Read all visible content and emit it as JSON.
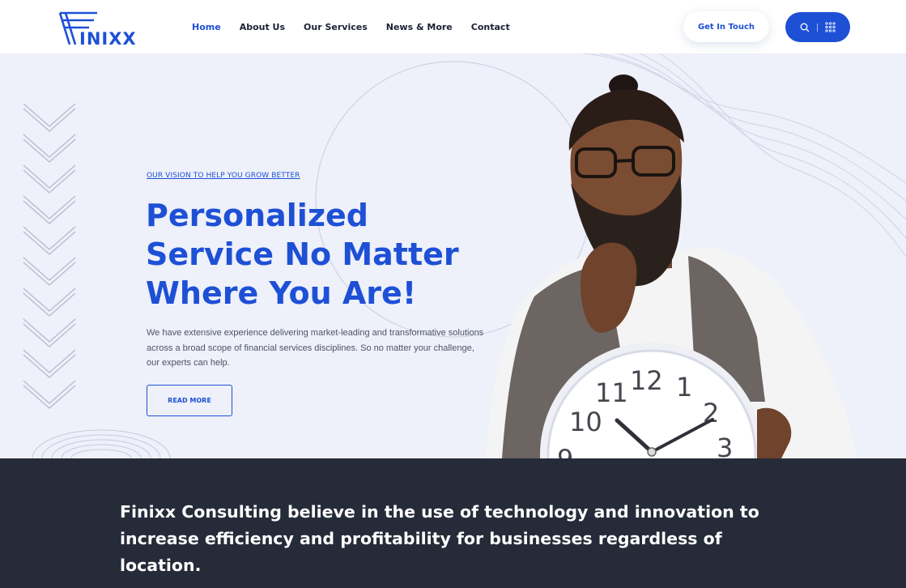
{
  "brand": {
    "name": "FINIXX",
    "accent": "#1e50d6",
    "dark": "#262b39"
  },
  "nav": {
    "items": [
      {
        "label": "Home",
        "active": true
      },
      {
        "label": "About Us",
        "active": false
      },
      {
        "label": "Our Services",
        "active": false
      },
      {
        "label": "News & More",
        "active": false
      },
      {
        "label": "Contact",
        "active": false
      }
    ]
  },
  "header": {
    "cta_label": "Get In Touch",
    "icons": [
      "search-icon",
      "grid-menu-icon"
    ]
  },
  "hero": {
    "eyebrow": "OUR VISION TO HELP YOU GROW BETTER",
    "headline": [
      "Personalized",
      "Service No Matter",
      "Where You Are!"
    ],
    "description": "We have extensive experience delivering market-leading and transformative solutions across a broad scope of financial services disciplines. So no matter your challenge, our experts can help.",
    "button_label": "READ MORE"
  },
  "clock": {
    "numerals": [
      "9",
      "10",
      "11",
      "12",
      "1",
      "2",
      "3"
    ]
  },
  "banner": {
    "text": "Finixx Consulting believe in the use of technology and innovation to increase efficiency and profitability for businesses regardless of location."
  }
}
